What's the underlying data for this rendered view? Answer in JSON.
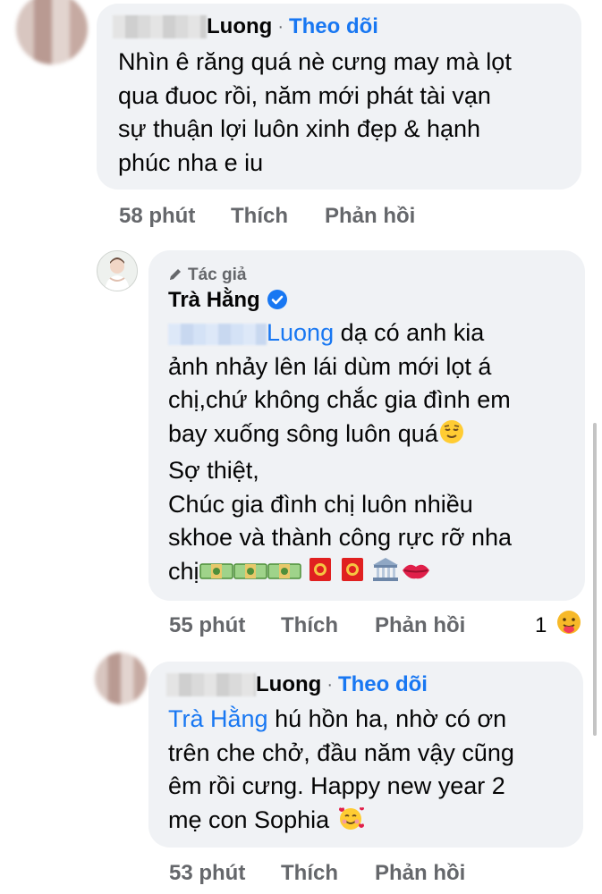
{
  "comments": [
    {
      "author": "Luong",
      "follow_label": "Theo dõi",
      "text_lines": [
        "Nhìn ê răng quá nè cưng may mà lọt",
        "qua đuoc rồi, năm mới phát tài vạn",
        "sự thuận lợi luôn xinh đẹp & hạnh",
        "phúc nha e iu"
      ],
      "time": "58 phút",
      "like_label": "Thích",
      "reply_label": "Phản hồi"
    },
    {
      "badge_label": "Tác giả",
      "author": "Trà Hằng",
      "mention": "Luong",
      "text_first": "dạ có anh kia",
      "text_lines": [
        "ảnh nhảy lên lái dùm mới lọt á",
        "chị,chứ không chắc gia đình em",
        "bay xuống sông luôn quá",
        "Sợ thiệt,",
        "Chúc gia đình chị luôn nhiều",
        "skhoe và thành công rực rỡ nha",
        "chị"
      ],
      "time": "55 phút",
      "like_label": "Thích",
      "reply_label": "Phản hồi",
      "reaction_count": "1"
    },
    {
      "author": "Luong",
      "follow_label": "Theo dõi",
      "mention": "Trà Hằng",
      "text_first": "hú hồn ha, nhờ có ơn",
      "text_lines": [
        "trên che chở, đầu năm vậy cũng",
        "êm rồi cưng. Happy new year 2",
        "mẹ con Sophia"
      ],
      "time": "53 phút",
      "like_label": "Thích",
      "reply_label": "Phản hồi"
    }
  ],
  "colors": {
    "bubble": "#f0f2f5",
    "link_blue": "#1877f2",
    "meta_gray": "#65676b"
  },
  "icons": [
    "pencil-icon",
    "verified-badge-icon",
    "relieved-face-emoji",
    "money-emoji",
    "red-envelope-emoji",
    "bank-emoji",
    "lips-emoji",
    "care-reaction-icon",
    "smiling-hearts-emoji"
  ]
}
